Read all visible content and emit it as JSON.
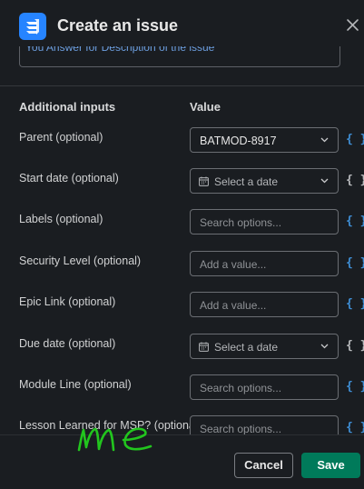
{
  "header": {
    "title": "Create an issue",
    "close_icon": "close-icon",
    "logo_icon": "jira-logo-icon"
  },
  "previous_field": {
    "text": "You Answer for Description of the issue"
  },
  "table": {
    "col_inputs": "Additional inputs",
    "col_value": "Value"
  },
  "rows": [
    {
      "label": "Parent (optional)",
      "kind": "select",
      "value": "BATMOD-8917",
      "brace": "{ }",
      "brace_color": "blue"
    },
    {
      "label": "Start date (optional)",
      "kind": "date",
      "value": "Select a date",
      "brace": "{ }",
      "brace_color": "gray"
    },
    {
      "label": "Labels (optional)",
      "kind": "search",
      "value": "Search options...",
      "brace": "{ }",
      "brace_color": "blue"
    },
    {
      "label": "Security Level (optional)",
      "kind": "input",
      "value": "Add a value...",
      "brace": "{ }",
      "brace_color": "blue"
    },
    {
      "label": "Epic Link (optional)",
      "kind": "input",
      "value": "Add a value...",
      "brace": "{ }",
      "brace_color": "blue"
    },
    {
      "label": "Due date (optional)",
      "kind": "date",
      "value": "Select a date",
      "brace": "{ }",
      "brace_color": "gray"
    },
    {
      "label": "Module Line (optional)",
      "kind": "search",
      "value": "Search options...",
      "brace": "{ }",
      "brace_color": "blue"
    },
    {
      "label": "Lesson Learned for MSP? (optional)",
      "kind": "search",
      "value": "Search options...",
      "brace": "{ }",
      "brace_color": "blue"
    }
  ],
  "footer": {
    "cancel_label": "Cancel",
    "save_label": "Save"
  },
  "annotation": {
    "text": "me",
    "color": "#22c51e"
  },
  "colors": {
    "accent": "#007a5a",
    "link": "#3f8fd6",
    "background": "#1a1d21"
  }
}
